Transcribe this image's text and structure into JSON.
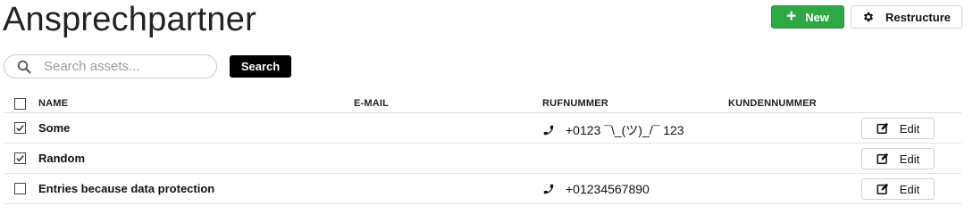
{
  "header": {
    "title": "Ansprechpartner",
    "new_label": "New",
    "restructure_label": "Restructure"
  },
  "search": {
    "placeholder": "Search assets...",
    "value": "",
    "button_label": "Search"
  },
  "table": {
    "columns": [
      "NAME",
      "E-MAIL",
      "RUFNUMMER",
      "KUNDENNUMMER"
    ],
    "rows": [
      {
        "checked": true,
        "name": "Some",
        "email": "",
        "phone": "+0123 ¯\\_(ツ)_/¯ 123",
        "customer_number": "",
        "edit_label": "Edit"
      },
      {
        "checked": true,
        "name": "Random",
        "email": "",
        "phone": "",
        "customer_number": "",
        "edit_label": "Edit"
      },
      {
        "checked": false,
        "name": "Entries because data protection",
        "email": "",
        "phone": "+01234567890",
        "customer_number": "",
        "edit_label": "Edit"
      }
    ]
  },
  "icons": {
    "new": "plus-icon",
    "restructure": "gear-icon",
    "search": "search-icon",
    "phone": "phone-icon",
    "edit": "edit-icon",
    "checkbox": "check-icon"
  },
  "colors": {
    "new_button": "#2ea844",
    "search_button": "#000000"
  }
}
